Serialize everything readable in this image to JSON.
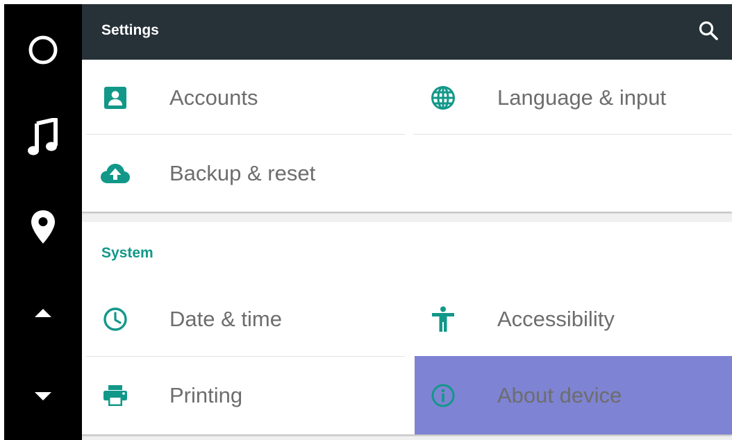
{
  "toolbar": {
    "title": "Settings"
  },
  "rail": {
    "items": [
      {
        "icon": "home-circle-icon"
      },
      {
        "icon": "music-note-icon"
      },
      {
        "icon": "map-pin-icon"
      },
      {
        "icon": "arrow-up-icon"
      },
      {
        "icon": "arrow-down-icon"
      }
    ]
  },
  "personal": {
    "items": [
      {
        "label": "Accounts",
        "icon": "account-box-icon"
      },
      {
        "label": "Language & input",
        "icon": "globe-icon"
      },
      {
        "label": "Backup & reset",
        "icon": "cloud-upload-icon"
      }
    ]
  },
  "system": {
    "header": "System",
    "items": [
      {
        "label": "Date & time",
        "icon": "clock-icon"
      },
      {
        "label": "Accessibility",
        "icon": "accessibility-icon"
      },
      {
        "label": "Printing",
        "icon": "printer-icon"
      },
      {
        "label": "About device",
        "icon": "info-icon",
        "selected": true
      }
    ]
  },
  "colors": {
    "accent": "#129889",
    "toolbar": "#263238",
    "selected": "#7f83d3",
    "rail": "#000000"
  }
}
